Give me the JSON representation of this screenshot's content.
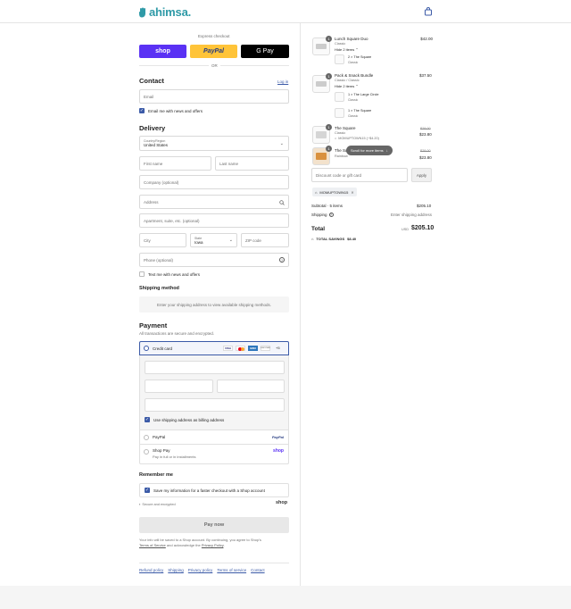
{
  "header": {
    "logo": "ahimsa."
  },
  "express": {
    "label": "Express checkout",
    "shop": "shop",
    "paypal": "PayPal",
    "gpay": "G Pay",
    "or": "OR"
  },
  "contact": {
    "title": "Contact",
    "login": "Log in",
    "email_placeholder": "Email",
    "news_label": "Email me with news and offers"
  },
  "delivery": {
    "title": "Delivery",
    "country_label": "Country/Region",
    "country_value": "United States",
    "first_name": "First name",
    "last_name": "Last name",
    "company": "Company (optional)",
    "address": "Address",
    "apartment": "Apartment, suite, etc. (optional)",
    "city": "City",
    "state_label": "State",
    "state_value": "Iowa",
    "zip": "ZIP code",
    "phone": "Phone (optional)",
    "text_label": "Text me with news and offers"
  },
  "shipping": {
    "title": "Shipping method",
    "note": "Enter your shipping address to view available shipping methods."
  },
  "payment": {
    "title": "Payment",
    "subtitle": "All transactions are secure and encrypted.",
    "credit_card": "Credit card",
    "card_brands": [
      "VISA",
      "MC",
      "AMEX",
      "DISCOVER"
    ],
    "more_brands": "+5",
    "billing_label": "Use shipping address as billing address",
    "paypal": "PayPal",
    "paypal_logo": "PayPal",
    "shoppay": "Shop Pay",
    "shoppay_sub": "Pay in full or in installments",
    "shoppay_logo": "shop"
  },
  "remember": {
    "title": "Remember me",
    "save_label": "Save my information for a faster checkout with a Shop account",
    "secure": "Secure and encrypted",
    "shop_logo": "shop"
  },
  "pay_button": "Pay now",
  "legal": {
    "text1": "Your info will be saved to a Shop account. By continuing, you agree to Shop's",
    "tos": "Terms of Service",
    "text2": "and acknowledge the",
    "privacy": "Privacy Policy",
    "period": "."
  },
  "footer_links": [
    "Refund policy",
    "Shipping",
    "Privacy policy",
    "Terms of service",
    "Contact"
  ],
  "cart": {
    "items": [
      {
        "qty": "1",
        "name": "Lunch Square Duo",
        "variant": "Classic",
        "toggle": "Hide 2 items",
        "price": "$42.00",
        "subitems": [
          {
            "name": "2 × The Square",
            "variant": "Classic"
          }
        ]
      },
      {
        "qty": "1",
        "name": "Pack & Snack Bundle",
        "variant": "Classic / Classic",
        "toggle": "Hide 2 items",
        "price": "$37.50",
        "subitems": [
          {
            "name": "1 × The Large Circle",
            "variant": "Classic"
          },
          {
            "name": "1 × The Square",
            "variant": "Classic"
          }
        ]
      },
      {
        "qty": "1",
        "name": "The Square",
        "variant": "Classic",
        "discount": "MOMUPTOWN15 (−$4.20)",
        "old_price": "$28.00",
        "price": "$23.80"
      },
      {
        "qty": "1",
        "name": "The Sq",
        "variant": "Rainbow",
        "old_price": "$28.00",
        "price": "$23.80"
      }
    ],
    "scroll_hint": "Scroll for more items",
    "discount_placeholder": "Discount code or gift card",
    "apply": "Apply",
    "applied_code": "MOMUPTOWN15",
    "subtotal_label": "Subtotal · 5 items",
    "subtotal_value": "$205.10",
    "shipping_label": "Shipping",
    "shipping_value": "Enter shipping address",
    "total_label": "Total",
    "currency": "USD",
    "total_value": "$205.10",
    "savings_label": "TOTAL SAVINGS",
    "savings_value": "$8.40"
  },
  "colors": {
    "accent": "#3b5aa7",
    "shop": "#5a31f4",
    "paypal": "#ffc439",
    "logo": "#2f9aa7"
  }
}
